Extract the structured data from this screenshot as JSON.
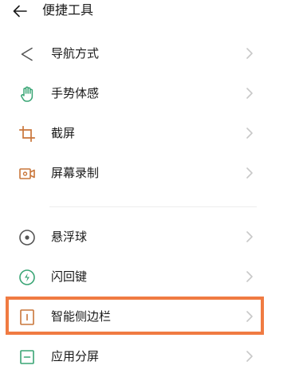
{
  "header": {
    "title": "便捷工具",
    "back_icon": "back-arrow-icon"
  },
  "colors": {
    "icon_gray": "#555555",
    "icon_green": "#3aa575",
    "icon_orange": "#c9763a",
    "chevron": "#c8c8c8",
    "highlight": "#f07b42"
  },
  "groups": [
    {
      "items": [
        {
          "label": "导航方式",
          "icon": "navigation-icon"
        },
        {
          "label": "手势体感",
          "icon": "gesture-hand-icon"
        },
        {
          "label": "截屏",
          "icon": "crop-screenshot-icon"
        },
        {
          "label": "屏幕录制",
          "icon": "screen-record-icon"
        }
      ]
    },
    {
      "items": [
        {
          "label": "悬浮球",
          "icon": "floating-ball-icon"
        },
        {
          "label": "闪回键",
          "icon": "flashback-key-icon"
        },
        {
          "label": "智能侧边栏",
          "icon": "smart-sidebar-icon",
          "highlighted": true
        },
        {
          "label": "应用分屏",
          "icon": "split-screen-icon"
        }
      ]
    }
  ]
}
